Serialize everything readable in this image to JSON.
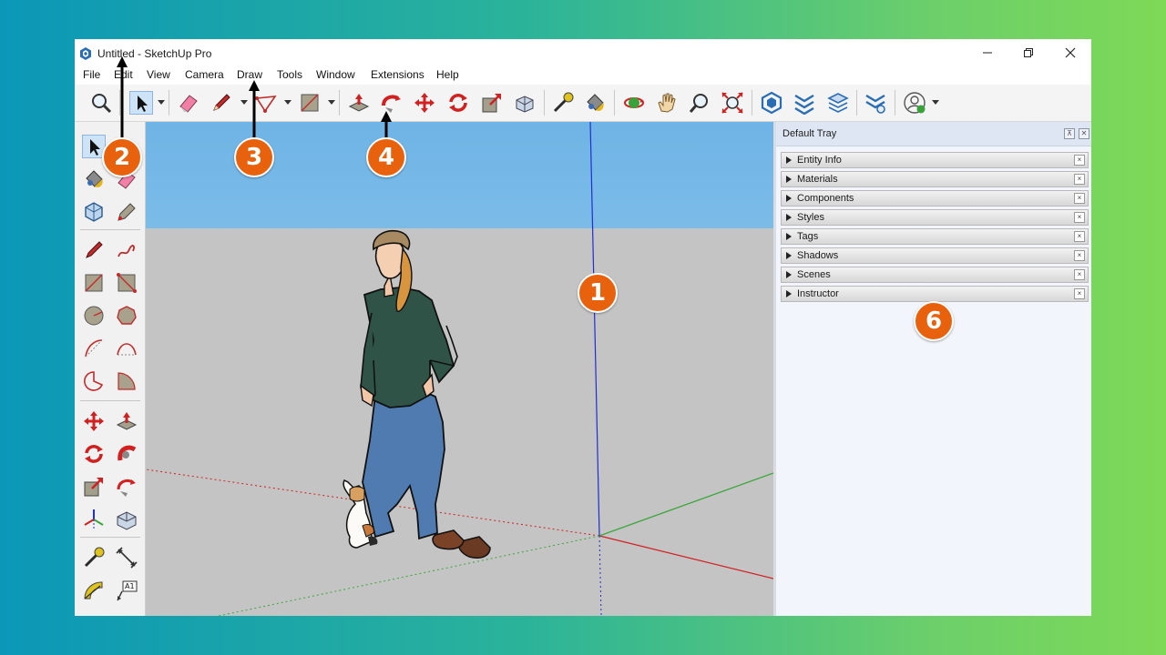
{
  "window": {
    "title": "Untitled - SketchUp Pro",
    "controls": [
      "minimize-icon",
      "restore-icon",
      "close-icon"
    ]
  },
  "menu": {
    "items": [
      "File",
      "Edit",
      "View",
      "Camera",
      "Draw",
      "Tools",
      "Window",
      "Extensions",
      "Help"
    ]
  },
  "toolbar": {
    "icons": [
      "zoom-icon",
      "select-icon",
      "eraser-icon",
      "pencil-icon",
      "freehand-icon",
      "rectangle-icon",
      "push-pull-icon",
      "follow-me-icon",
      "move-icon",
      "rotate-icon",
      "scale-icon",
      "offset-icon",
      "tape-measure-icon",
      "paint-bucket-icon",
      "orbit-icon",
      "pan-icon",
      "zoom-tool-icon",
      "zoom-extents-icon",
      "3d-warehouse-icon",
      "extension-warehouse-icon",
      "layout-icon",
      "extension-manager-icon",
      "account-icon"
    ]
  },
  "left_toolbar": {
    "icons": [
      "select-icon",
      "eraser-icon",
      "paint-bucket-icon",
      "tape-icon",
      "component-icon",
      "tag-icon",
      "line-icon",
      "freehand-icon",
      "rectangle-icon",
      "rotated-rectangle-icon",
      "circle-icon",
      "polygon-icon",
      "arc-icon",
      "two-point-arc-icon",
      "pie-icon",
      "three-point-arc-icon",
      "move-icon",
      "push-pull-icon",
      "rotate-icon",
      "follow-me-icon",
      "scale-icon",
      "offset-icon",
      "axes-icon",
      "section-icon",
      "tape-measure-icon",
      "dimension-icon",
      "protractor-icon",
      "text-icon"
    ],
    "text_label": "A1"
  },
  "tray": {
    "title": "Default Tray",
    "panels": [
      "Entity Info",
      "Materials",
      "Components",
      "Styles",
      "Tags",
      "Shadows",
      "Scenes",
      "Instructor"
    ]
  },
  "callouts": [
    "1",
    "2",
    "3",
    "4",
    "6"
  ],
  "colors": {
    "badge": "#e8620e",
    "sky_top": "#6fb4e6",
    "ground": "#c4c4c4",
    "axis_red": "#d22020",
    "axis_green": "#3aa63a",
    "axis_blue": "#1f2fd0"
  }
}
